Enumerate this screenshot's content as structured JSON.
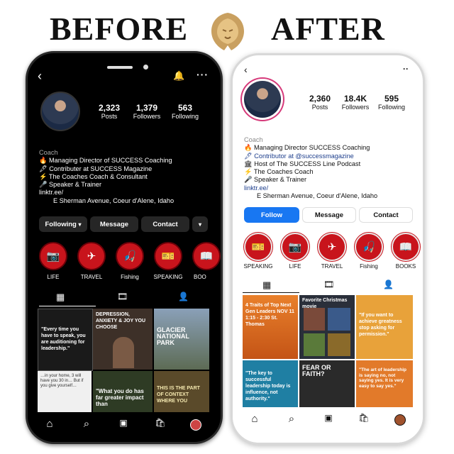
{
  "header": {
    "before": "BEFORE",
    "after": "AFTER"
  },
  "before_profile": {
    "stats": [
      {
        "num": "2,323",
        "label": "Posts"
      },
      {
        "num": "1,379",
        "label": "Followers"
      },
      {
        "num": "563",
        "label": "Following"
      }
    ],
    "bio": [
      "Coach",
      "🔥 Managing Director of SUCCESS Coaching",
      "🖋 Contributer at SUCCESS Magazine",
      "⚡ The Coaches Coach & Consultant",
      "🎤 Speaker & Trainer",
      "linktr.ee/",
      "E Sherman Avenue, Coeur d'Alene, Idaho"
    ],
    "buttons": {
      "following": "Following",
      "message": "Message",
      "contact": "Contact"
    },
    "highlights": [
      "LIFE",
      "TRAVEL",
      "Fishing",
      "SPEAKING",
      "BOO"
    ],
    "posts": [
      "\"Every time you have to speak, you are auditioning for leadership.\"",
      "DEPRESSION, ANXIETY & JOY YOU CHOOSE",
      "GLACIER NATIONAL PARK",
      "…in your home, 3 will have you 30 in… But if you give yourself…",
      "\"What you do has far greater impact than",
      "THIS IS THE PART OF CONTEXT WHERE YOU"
    ]
  },
  "after_profile": {
    "stats": [
      {
        "num": "2,360",
        "label": "Posts"
      },
      {
        "num": "18.4K",
        "label": "Followers"
      },
      {
        "num": "595",
        "label": "Following"
      }
    ],
    "bio": [
      "Coach",
      "🔥 Managing Director SUCCESS Coaching",
      "🖋 Contributor at @successmagazine",
      "🏛 Host of The SUCCESS Line Podcast",
      "⚡ The Coaches Coach",
      "🎤 Speaker & Trainer",
      "linktr.ee/",
      "E Sherman Avenue, Coeur d'Alene, Idaho"
    ],
    "buttons": {
      "follow": "Follow",
      "message": "Message",
      "contact": "Contact"
    },
    "highlights": [
      "SPEAKING",
      "LIFE",
      "TRAVEL",
      "Fishing",
      "BOOKS"
    ],
    "posts": [
      "4 Traits of Top Next Gen Leaders NOV 11 1:15 - 2:30 St. Thomas",
      "Favorite Christmas movie",
      "\"If you want to achieve greatness stop asking for permission.\"",
      "\"The key to successful leadership today is influence, not authority.\"",
      "FEAR OR FAITH?",
      "\"The art of leadership is saying no, not saying yes. It is very easy to say yes.\""
    ]
  }
}
